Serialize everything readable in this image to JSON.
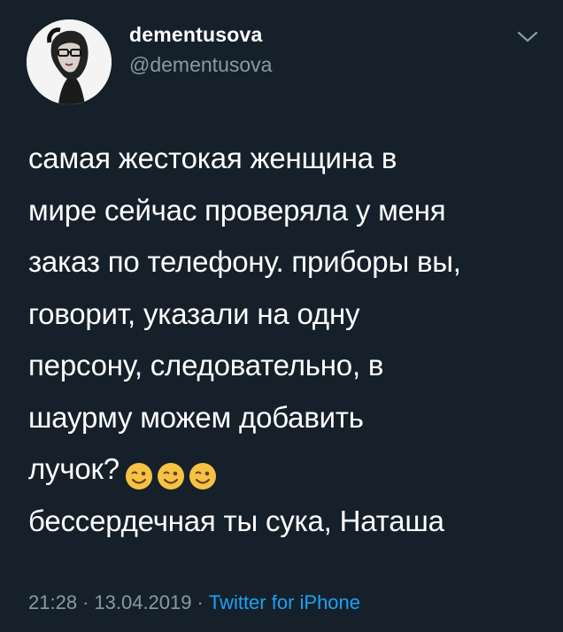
{
  "user": {
    "display_name": "dementusova",
    "handle": "@dementusova"
  },
  "tweet": {
    "lines": [
      "самая жестокая женщина в",
      "мире сейчас проверяла у меня",
      "заказ по телефону. приборы вы,",
      "говорит, указали на одну",
      "персону, следовательно, в",
      "шаурму можем добавить",
      "лучок?",
      "бессердечная ты сука, Наташа"
    ],
    "emojis": [
      "winking-face-icon",
      "winking-face-icon",
      "winking-face-icon"
    ]
  },
  "meta": {
    "time": "21:28",
    "separator": "·",
    "date": "13.04.2019",
    "source": "Twitter for iPhone"
  },
  "colors": {
    "background": "#15202b",
    "text": "#ffffff",
    "secondary": "#8899a6",
    "link": "#1da1f2",
    "emoji_face": "#f6c244"
  },
  "icons": {
    "menu": "chevron-down-icon",
    "avatar": "profile-photo"
  }
}
